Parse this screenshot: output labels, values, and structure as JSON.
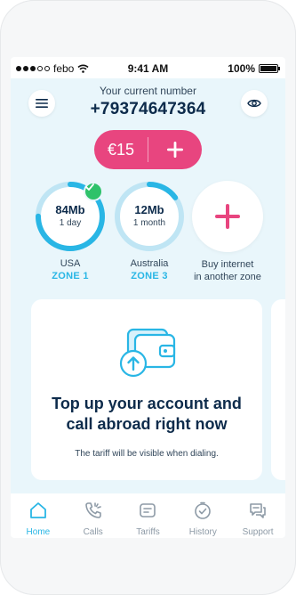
{
  "status_bar": {
    "carrier": "febo",
    "time": "9:41 AM",
    "battery": "100%"
  },
  "header": {
    "number_label": "Your current number",
    "number": "+79374647364",
    "menu_icon": "menu-icon",
    "visibility_icon": "eye-icon"
  },
  "balance": {
    "amount": "€15",
    "add_icon": "plus-icon"
  },
  "packages": [
    {
      "amount": "84Mb",
      "period": "1 day",
      "country": "USA",
      "zone": "ZONE 1",
      "remaining_fraction": 0.75,
      "active": true
    },
    {
      "amount": "12Mb",
      "period": "1 month",
      "country": "Australia",
      "zone": "ZONE 3",
      "remaining_fraction": 0.15,
      "active": false
    }
  ],
  "buy_internet": {
    "line1": "Buy internet",
    "line2": "in another zone"
  },
  "promo": {
    "title_line1": "Top up your account and",
    "title_line2": "call abroad right now",
    "subtitle": "The tariff will be visible when dialing.",
    "icon": "wallet-icon"
  },
  "tabs": [
    {
      "label": "Home",
      "icon": "home-icon",
      "active": true
    },
    {
      "label": "Calls",
      "icon": "phone-icon",
      "active": false
    },
    {
      "label": "Tariffs",
      "icon": "tariffs-icon",
      "active": false
    },
    {
      "label": "History",
      "icon": "history-icon",
      "active": false
    },
    {
      "label": "Support",
      "icon": "support-icon",
      "active": false
    }
  ],
  "colors": {
    "accent": "#29b6e5",
    "brand_pink": "#e8457f",
    "success": "#2ec26a",
    "text_dark": "#0d2b4b",
    "screen_bg": "#e9f6fb"
  }
}
